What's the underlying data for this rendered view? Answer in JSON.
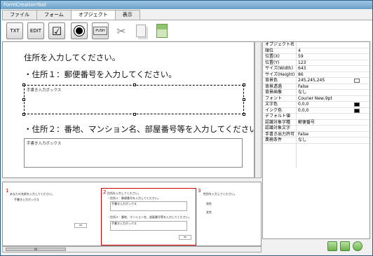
{
  "window": {
    "title": "FormCreationTool"
  },
  "tabs": [
    {
      "label": "ファイル"
    },
    {
      "label": "フォーム"
    },
    {
      "label": "オブジェクト"
    },
    {
      "label": "表示"
    }
  ],
  "toolbar": {
    "txt_label": "TXT",
    "edit_label": "EDIT",
    "push_label": "PUSH"
  },
  "form": {
    "q1": "住所を入力してください。",
    "q2": "・住所１：郵便番号を入力してください。",
    "box1_label": "手書き入力ボックス",
    "q3": "・住所２：番地、マンション名、部屋番号等を入力してください。",
    "box2_label": "手書き入力ボックス"
  },
  "properties": {
    "rows": [
      {
        "key": "オブジェクト名",
        "value": ""
      },
      {
        "key": "順位",
        "value": "4"
      },
      {
        "key": "位置(X)",
        "value": "59"
      },
      {
        "key": "位置(Y)",
        "value": "123"
      },
      {
        "key": "サイズ(Width)",
        "value": "643"
      },
      {
        "key": "サイズ(Height)",
        "value": "86"
      },
      {
        "key": "背景色",
        "value": "245,245,245"
      },
      {
        "key": "背景透過",
        "value": "False"
      },
      {
        "key": "背景画像",
        "value": "なし"
      },
      {
        "key": "フォント",
        "value": "Courier New,9pt"
      },
      {
        "key": "文字色",
        "value": "0,0,0"
      },
      {
        "key": "インク色",
        "value": "0,0,0"
      },
      {
        "key": "デフォルト値",
        "value": ""
      },
      {
        "key": "認識対象字種",
        "value": "郵便番号"
      },
      {
        "key": "認識対象文字",
        "value": ""
      },
      {
        "key": "手書き出力許可",
        "value": "False"
      },
      {
        "key": "業務条件",
        "value": "なし"
      }
    ],
    "colors": {
      "bg": "#f5f5f5",
      "text": "#000000",
      "ink": "#000000"
    }
  },
  "thumbnails": [
    {
      "num": "1",
      "lines": [
        "あなたの名前を入力してください。",
        "手書き入力ボックス"
      ],
      "button": "OK"
    },
    {
      "num": "2",
      "lines": [
        "住所を入力してください。",
        "・住所１：郵便番号を入力してください。",
        "手書き入力ボックス",
        "・住所２：番地、マンション名、部屋番号等を入力してください。",
        "手書き入力ボックス"
      ],
      "button": "OK"
    },
    {
      "num": "3",
      "lines": [
        "性別を入力してください。",
        "男性",
        "女性"
      ]
    }
  ],
  "scrollbar": {
    "thumb_label": "III"
  }
}
